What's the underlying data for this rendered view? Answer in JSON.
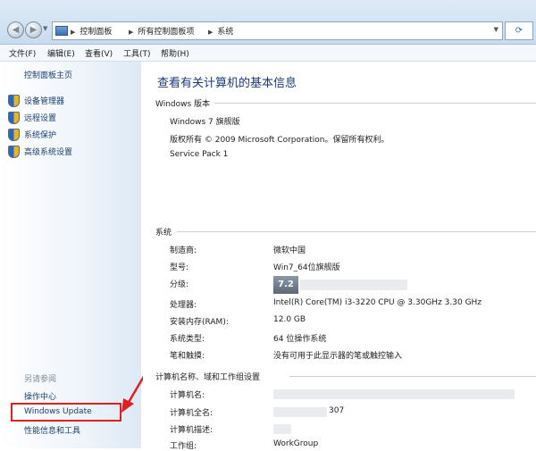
{
  "breadcrumb": {
    "items": [
      "控制面板",
      "所有控制面板项",
      "系统"
    ]
  },
  "menubar": {
    "items": [
      "文件(F)",
      "编辑(E)",
      "查看(V)",
      "工具(T)",
      "帮助(H)"
    ]
  },
  "sidebar": {
    "home": "控制面板主页",
    "links": [
      "设备管理器",
      "远程设置",
      "系统保护",
      "高级系统设置"
    ],
    "see_also": "另请参阅",
    "bottom_links": [
      "操作中心",
      "Windows Update",
      "性能信息和工具"
    ]
  },
  "main": {
    "title": "查看有关计算机的基本信息",
    "windows_section": {
      "header": "Windows 版本",
      "edition": "Windows 7 旗舰版",
      "copyright": "版权所有 © 2009 Microsoft Corporation。保留所有权利。",
      "service_pack": "Service Pack 1"
    },
    "system_section": {
      "header": "系统",
      "rows": [
        {
          "label": "制造商:",
          "value": "微软中国"
        },
        {
          "label": "型号:",
          "value": "Win7_64位旗舰版"
        },
        {
          "label": "分级:",
          "value": ""
        },
        {
          "label": "处理器:",
          "value": "Intel(R) Core(TM) i3-3220 CPU @ 3.30GHz   3.30 GHz"
        },
        {
          "label": "安装内存(RAM):",
          "value": "12.0 GB"
        },
        {
          "label": "系统类型:",
          "value": "64 位操作系统"
        },
        {
          "label": "笔和触摸:",
          "value": "没有可用于此显示器的笔或触控输入"
        }
      ],
      "rating_score": "7.2"
    },
    "computer_section": {
      "header": "计算机名称、域和工作组设置",
      "rows": [
        {
          "label": "计算机名:",
          "value": ""
        },
        {
          "label": "计算机全名:",
          "value": "307"
        },
        {
          "label": "计算机描述:",
          "value": ""
        },
        {
          "label": "工作组:",
          "value": "WorkGroup"
        }
      ]
    }
  },
  "colors": {
    "highlight": "#e02020",
    "link": "#1c3d6e",
    "title": "#1a3a78"
  }
}
